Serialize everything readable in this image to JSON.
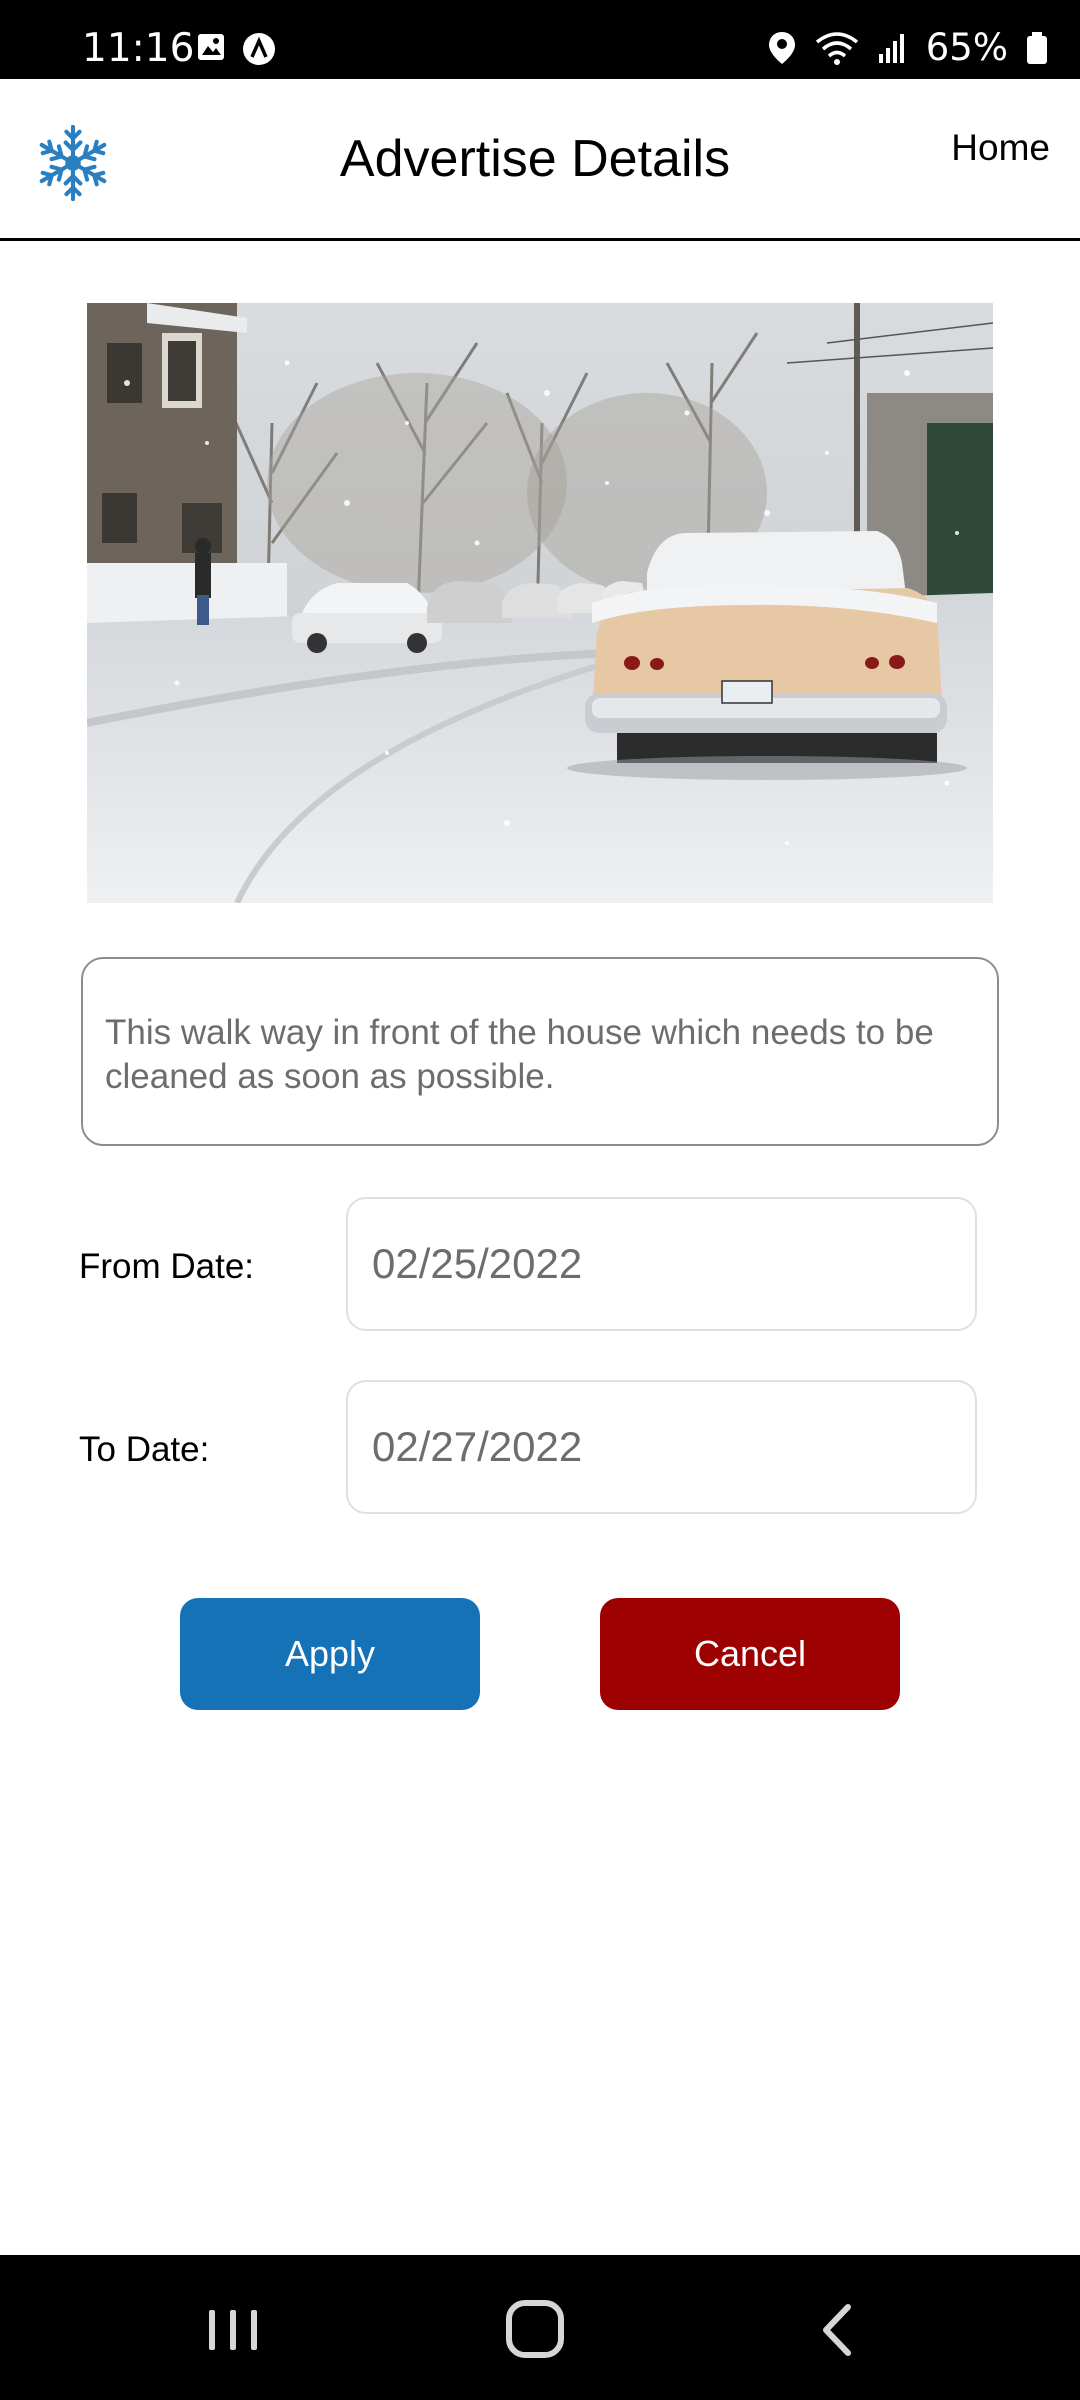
{
  "status_bar": {
    "time": "11:16",
    "battery": "65%",
    "icons": [
      "image-icon",
      "a-circle-icon",
      "location-icon",
      "wifi-icon",
      "signal-icon",
      "battery-icon"
    ]
  },
  "header": {
    "logo_icon": "snowflake-icon",
    "title": "Advertise Details",
    "home_link": "Home"
  },
  "advertisement": {
    "photo": "snowy-street-with-parked-cars",
    "description": "This walk way in front of the house which needs to be cleaned as soon as possible."
  },
  "form": {
    "from_date_label": "From Date:",
    "from_date_value": "02/25/2022",
    "to_date_label": "To Date:",
    "to_date_value": "02/27/2022"
  },
  "actions": {
    "apply_label": "Apply",
    "cancel_label": "Cancel"
  },
  "colors": {
    "apply": "#1572b6",
    "cancel": "#9d0000",
    "logo": "#2a7fc1"
  },
  "nav_bar": {
    "icons": [
      "recents-icon",
      "home-icon",
      "back-icon"
    ]
  }
}
